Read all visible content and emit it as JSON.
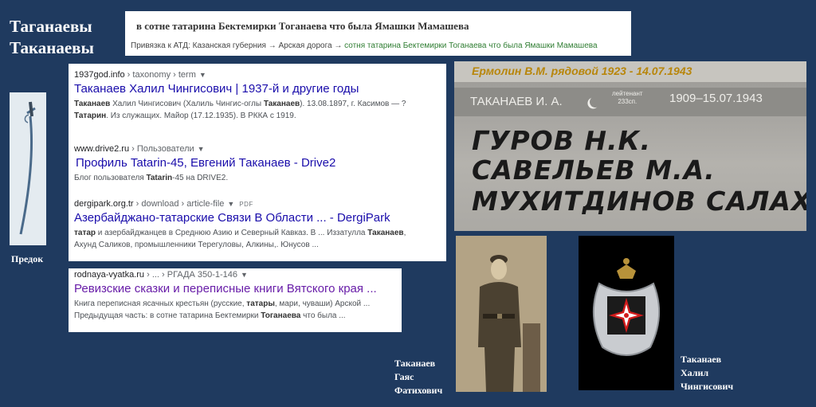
{
  "family": {
    "name1": "Таганаевы",
    "name2": "Таканаевы"
  },
  "ancestor_caption": "Предок",
  "header": {
    "title": "в сотне татарина Бектемирки Тоганаева что была Ямашки Мамашева",
    "crumb_prefix": "Привязка к АТД: Казанская губерния → Арская дорога →",
    "crumb_link": "сотня татарина Бектемирки Тоганаева что была Ямашки Мамашева"
  },
  "results": [
    {
      "site": "1937god.info",
      "path": " › taxonomy › term",
      "title": "Таканаев Халил Чингисович | 1937-й и другие годы",
      "snippet1_parts": [
        "",
        "Таканаев",
        " Халил Чингисович (Халиль Чингис-оглы ",
        "Таканаев",
        "). 13.08.1897, г. Касимов — ?"
      ],
      "snippet2_parts": [
        "",
        "Татарин",
        ". Из служащих. Майор (17.12.1935). В РККА с 1919."
      ]
    },
    {
      "site": "www.drive2.ru",
      "path": " › Пользователи",
      "title": "Профиль Tatarin-45, Евгений Таканаев - Drive2",
      "snippet1_parts": [
        "Блог пользователя ",
        "Tatarin",
        "-45 на DRIVE2."
      ]
    },
    {
      "site": "dergipark.org.tr",
      "path": " › download › article-file",
      "pdf": "PDF",
      "title": "Азербайджано-татарские Связи В Области ... - DergiPark",
      "snippet1_parts": [
        "",
        "татар",
        " и азербайджанцев в Среднюю Азию и Северный Кавказ. В ... Иззатулла ",
        "Таканаев",
        ","
      ],
      "snippet2_parts": [
        "Ахунд Саликов, промышленники Терегуловы, Алкины,. Юнусов ..."
      ]
    },
    {
      "site": "rodnaya-vyatka.ru",
      "path": " › ... › РГАДА 350-1-146",
      "title": "Ревизские сказки и переписные книги Вятского края ...",
      "snippet1_parts": [
        "Книга переписная ясачных крестьян (русские, ",
        "татары",
        ", мари, чуваши) Арской ..."
      ],
      "snippet2_parts": [
        "Предыдущая часть: в сотне татарина Бектемирки ",
        "Тоганаева",
        " что была ..."
      ]
    }
  ],
  "plaque": {
    "line1": "Ермолин В.М.   рядовой  1923 - 14.07.1943",
    "name2": "ТАКАНАЕВ И. А.",
    "rank": "лейтенант",
    "unit": "233сп.",
    "dates2": "1909–15.07.1943",
    "hand1": "ГУРОВ Н.К.",
    "hand2": "САВЕЛЬЕВ М.А.",
    "hand3": "МУХИТДИНОВ САЛАХ"
  },
  "soldier_caption": [
    "Таканаев",
    "Гаяс",
    "Фатихович"
  ],
  "emblem_caption": [
    "Таканаев",
    "Халил",
    "Чингисович"
  ],
  "icons": {
    "saber": "saber-icon",
    "emblem": "military-emblem-icon",
    "crescent": "crescent-star-icon"
  }
}
